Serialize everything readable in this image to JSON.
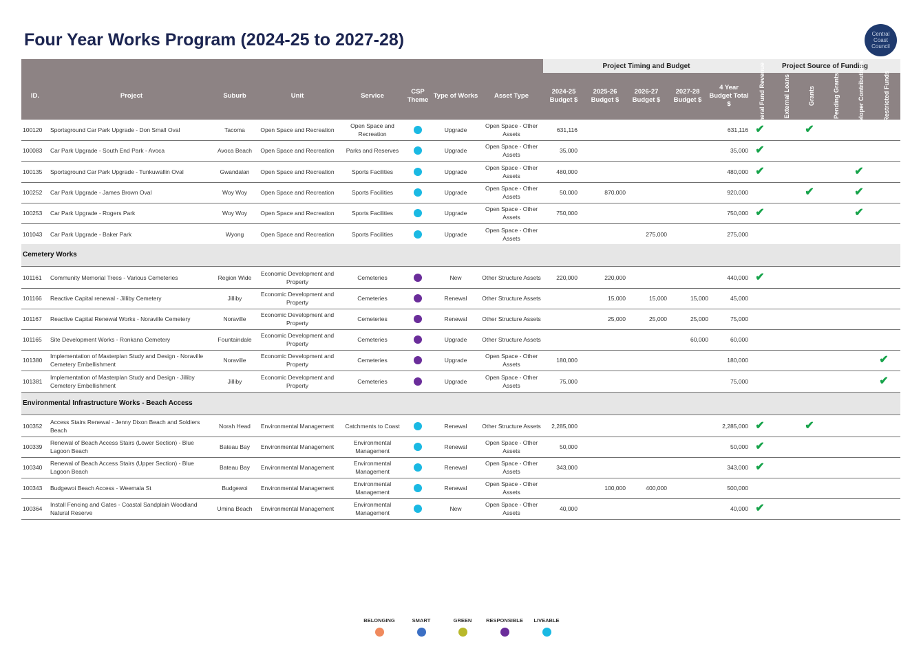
{
  "title": "Four Year Works Program (2024-25 to 2027-28)",
  "logo_text": "Central Coast Council",
  "banners": {
    "timing": "Project Timing and Budget",
    "funding": "Project Source of Funding"
  },
  "headers": {
    "id": "ID.",
    "project": "Project",
    "suburb": "Suburb",
    "unit": "Unit",
    "service": "Service",
    "csp_theme": "CSP Theme",
    "type_of_works": "Type of Works",
    "asset_type": "Asset Type",
    "b2425": "2024-25 Budget $",
    "b2526": "2025-26 Budget $",
    "b2627": "2026-27 Budget $",
    "b2728": "2027-28 Budget $",
    "total": "4 Year Budget Total $",
    "f_general": "General Fund Revenue",
    "f_loans": "External Loans",
    "f_grants": "Grants",
    "f_pending": "Pending Grants",
    "f_dev": "Developer Contributions",
    "f_restricted": "Restricted Funds"
  },
  "colors": {
    "header_bg": "#8d8384",
    "liveable": "#1ab9e3",
    "responsible": "#6a2d9a",
    "tick": "#16a34a"
  },
  "tick_glyph": "✔",
  "group1_rows": [
    {
      "id": "100120",
      "project": "Sportsground Car Park Upgrade - Don Small Oval",
      "suburb": "Tacoma",
      "unit": "Open Space and Recreation",
      "service": "Open Space and Recreation",
      "theme": "liveable",
      "type": "Upgrade",
      "asset": "Open Space - Other Assets",
      "b1": "631,116",
      "b2": "",
      "b3": "",
      "b4": "",
      "total": "631,116",
      "f": [
        1,
        0,
        1,
        0,
        0,
        0
      ]
    },
    {
      "id": "100083",
      "project": "Car Park Upgrade - South End Park - Avoca",
      "suburb": "Avoca Beach",
      "unit": "Open Space and Recreation",
      "service": "Parks and Reserves",
      "theme": "liveable",
      "type": "Upgrade",
      "asset": "Open Space - Other Assets",
      "b1": "35,000",
      "b2": "",
      "b3": "",
      "b4": "",
      "total": "35,000",
      "f": [
        1,
        0,
        0,
        0,
        0,
        0
      ]
    },
    {
      "id": "100135",
      "project": "Sportsground Car Park Upgrade - Tunkuwallin Oval",
      "suburb": "Gwandalan",
      "unit": "Open Space and Recreation",
      "service": "Sports Facilities",
      "theme": "liveable",
      "type": "Upgrade",
      "asset": "Open Space - Other Assets",
      "b1": "480,000",
      "b2": "",
      "b3": "",
      "b4": "",
      "total": "480,000",
      "f": [
        1,
        0,
        0,
        0,
        1,
        0
      ]
    },
    {
      "id": "100252",
      "project": "Car Park Upgrade - James Brown Oval",
      "suburb": "Woy Woy",
      "unit": "Open Space and Recreation",
      "service": "Sports Facilities",
      "theme": "liveable",
      "type": "Upgrade",
      "asset": "Open Space - Other Assets",
      "b1": "50,000",
      "b2": "870,000",
      "b3": "",
      "b4": "",
      "total": "920,000",
      "f": [
        0,
        0,
        1,
        0,
        1,
        0
      ]
    },
    {
      "id": "100253",
      "project": "Car Park Upgrade - Rogers Park",
      "suburb": "Woy Woy",
      "unit": "Open Space and Recreation",
      "service": "Sports Facilities",
      "theme": "liveable",
      "type": "Upgrade",
      "asset": "Open Space - Other Assets",
      "b1": "750,000",
      "b2": "",
      "b3": "",
      "b4": "",
      "total": "750,000",
      "f": [
        1,
        0,
        0,
        0,
        1,
        0
      ]
    },
    {
      "id": "101043",
      "project": "Car Park Upgrade - Baker Park",
      "suburb": "Wyong",
      "unit": "Open Space and Recreation",
      "service": "Sports Facilities",
      "theme": "liveable",
      "type": "Upgrade",
      "asset": "Open Space - Other Assets",
      "b1": "",
      "b2": "",
      "b3": "275,000",
      "b4": "",
      "total": "275,000",
      "f": [
        0,
        0,
        0,
        0,
        0,
        0
      ]
    }
  ],
  "section2_title": "Cemetery Works",
  "group2_rows": [
    {
      "id": "101161",
      "project": "Community Memorial Trees - Various Cemeteries",
      "suburb": "Region Wide",
      "unit": "Economic Development and Property",
      "service": "Cemeteries",
      "theme": "responsible",
      "type": "New",
      "asset": "Other Structure Assets",
      "b1": "220,000",
      "b2": "220,000",
      "b3": "",
      "b4": "",
      "total": "440,000",
      "f": [
        1,
        0,
        0,
        0,
        0,
        0
      ]
    },
    {
      "id": "101166",
      "project": "Reactive Capital renewal - Jilliby Cemetery",
      "suburb": "Jilliby",
      "unit": "Economic Development and Property",
      "service": "Cemeteries",
      "theme": "responsible",
      "type": "Renewal",
      "asset": "Other Structure Assets",
      "b1": "",
      "b2": "15,000",
      "b3": "15,000",
      "b4": "15,000",
      "total": "45,000",
      "f": [
        0,
        0,
        0,
        0,
        0,
        0
      ]
    },
    {
      "id": "101167",
      "project": "Reactive Capital Renewal Works - Noraville Cemetery",
      "suburb": "Noraville",
      "unit": "Economic Development and Property",
      "service": "Cemeteries",
      "theme": "responsible",
      "type": "Renewal",
      "asset": "Other Structure Assets",
      "b1": "",
      "b2": "25,000",
      "b3": "25,000",
      "b4": "25,000",
      "total": "75,000",
      "f": [
        0,
        0,
        0,
        0,
        0,
        0
      ]
    },
    {
      "id": "101165",
      "project": "Site Development Works - Ronkana Cemetery",
      "suburb": "Fountaindale",
      "unit": "Economic Development and Property",
      "service": "Cemeteries",
      "theme": "responsible",
      "type": "Upgrade",
      "asset": "Other Structure Assets",
      "b1": "",
      "b2": "",
      "b3": "",
      "b4": "60,000",
      "total": "60,000",
      "f": [
        0,
        0,
        0,
        0,
        0,
        0
      ]
    },
    {
      "id": "101380",
      "project": "Implementation of Masterplan Study and Design - Noraville Cemetery Embellishment",
      "suburb": "Noraville",
      "unit": "Economic Development and Property",
      "service": "Cemeteries",
      "theme": "responsible",
      "type": "Upgrade",
      "asset": "Open Space - Other Assets",
      "b1": "180,000",
      "b2": "",
      "b3": "",
      "b4": "",
      "total": "180,000",
      "f": [
        0,
        0,
        0,
        0,
        0,
        1
      ]
    },
    {
      "id": "101381",
      "project": "Implementation of Masterplan Study and Design - Jilliby Cemetery Embellishment",
      "suburb": "Jilliby",
      "unit": "Economic Development and Property",
      "service": "Cemeteries",
      "theme": "responsible",
      "type": "Upgrade",
      "asset": "Open Space - Other Assets",
      "b1": "75,000",
      "b2": "",
      "b3": "",
      "b4": "",
      "total": "75,000",
      "f": [
        0,
        0,
        0,
        0,
        0,
        1
      ]
    }
  ],
  "section3_title": "Environmental Infrastructure Works - Beach Access",
  "group3_rows": [
    {
      "id": "100352",
      "project": "Access Stairs Renewal - Jenny Dixon Beach and  Soldiers Beach",
      "suburb": "Norah Head",
      "unit": "Environmental Management",
      "service": "Catchments to Coast",
      "theme": "liveable",
      "type": "Renewal",
      "asset": "Other Structure Assets",
      "b1": "2,285,000",
      "b2": "",
      "b3": "",
      "b4": "",
      "total": "2,285,000",
      "f": [
        1,
        0,
        1,
        0,
        0,
        0
      ]
    },
    {
      "id": "100339",
      "project": "Renewal of Beach Access Stairs (Lower Section) - Blue Lagoon Beach",
      "suburb": "Bateau Bay",
      "unit": "Environmental Management",
      "service": "Environmental Management",
      "theme": "liveable",
      "type": "Renewal",
      "asset": "Open Space - Other Assets",
      "b1": "50,000",
      "b2": "",
      "b3": "",
      "b4": "",
      "total": "50,000",
      "f": [
        1,
        0,
        0,
        0,
        0,
        0
      ]
    },
    {
      "id": "100340",
      "project": "Renewal of Beach Access Stairs (Upper Section) - Blue Lagoon Beach",
      "suburb": "Bateau Bay",
      "unit": "Environmental Management",
      "service": "Environmental Management",
      "theme": "liveable",
      "type": "Renewal",
      "asset": "Open Space - Other Assets",
      "b1": "343,000",
      "b2": "",
      "b3": "",
      "b4": "",
      "total": "343,000",
      "f": [
        1,
        0,
        0,
        0,
        0,
        0
      ]
    },
    {
      "id": "100343",
      "project": "Budgewoi Beach Access - Weemala St",
      "suburb": "Budgewoi",
      "unit": "Environmental Management",
      "service": "Environmental Management",
      "theme": "liveable",
      "type": "Renewal",
      "asset": "Open Space - Other Assets",
      "b1": "",
      "b2": "100,000",
      "b3": "400,000",
      "b4": "",
      "total": "500,000",
      "f": [
        0,
        0,
        0,
        0,
        0,
        0
      ]
    },
    {
      "id": "100364",
      "project": "Install Fencing and Gates - Coastal Sandplain Woodland Natural Reserve",
      "suburb": "Umina Beach",
      "unit": "Environmental Management",
      "service": "Environmental Management",
      "theme": "liveable",
      "type": "New",
      "asset": "Open Space - Other Assets",
      "b1": "40,000",
      "b2": "",
      "b3": "",
      "b4": "",
      "total": "40,000",
      "f": [
        1,
        0,
        0,
        0,
        0,
        0
      ]
    }
  ],
  "legend": [
    {
      "label": "BELONGING",
      "color": "#f08a5d"
    },
    {
      "label": "SMART",
      "color": "#3b6fc4"
    },
    {
      "label": "GREEN",
      "color": "#b8b82a"
    },
    {
      "label": "RESPONSIBLE",
      "color": "#6a2d9a"
    },
    {
      "label": "LIVEABLE",
      "color": "#1ab9e3"
    }
  ]
}
